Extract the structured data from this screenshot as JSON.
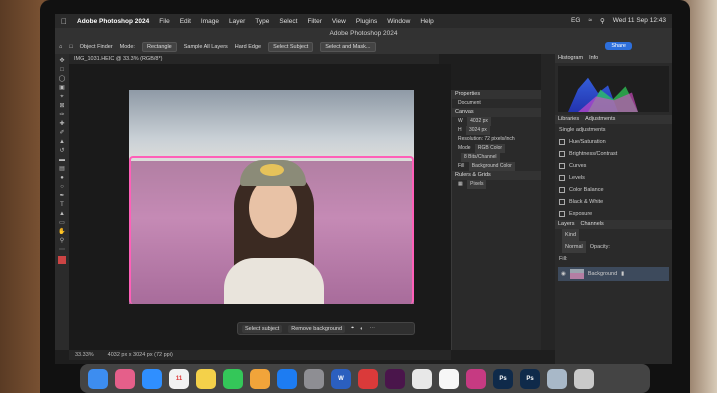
{
  "menubar": {
    "app_name": "Adobe Photoshop 2024",
    "items": [
      "File",
      "Edit",
      "Image",
      "Layer",
      "Type",
      "Select",
      "Filter",
      "View",
      "Plugins",
      "Window",
      "Help"
    ],
    "clock": "Wed 11 Sep 12:43",
    "input_indicator": "EG"
  },
  "titlebar": {
    "title": "Adobe Photoshop 2024"
  },
  "options": {
    "object_finder": "Object Finder",
    "mode_label": "Mode:",
    "mode_value": "Rectangle",
    "sample_all_layers": "Sample All Layers",
    "hard_edge": "Hard Edge",
    "select_subject": "Select Subject",
    "select_and_mask": "Select and Mask...",
    "share": "Share"
  },
  "document": {
    "tab_title": "IMG_1031.HEIC @ 33.3% (RGB/8*)"
  },
  "context_bar": {
    "select_subject": "Select subject",
    "remove_background": "Remove background"
  },
  "status": {
    "zoom": "33.33%",
    "dimensions": "4032 px x 3024 px (72 ppi)"
  },
  "properties": {
    "header": "Properties",
    "document_label": "Document",
    "canvas_header": "Canvas",
    "width": "4032 px",
    "height": "3024 px",
    "resolution": "Resolution: 72 pixels/inch",
    "mode_label": "Mode",
    "mode_value": "RGB Color",
    "bits_value": "8 Bits/Channel",
    "fill_label": "Fill",
    "fill_value": "Background Color",
    "rulers_header": "Rulers & Grids",
    "units_value": "Pixels"
  },
  "right_panel": {
    "tabs_top": [
      "Histogram",
      "Info"
    ],
    "tabs_mid": [
      "Libraries",
      "Adjustments"
    ],
    "single_adjustments": "Single adjustments",
    "adjustments": [
      "Hue/Saturation",
      "Brightness/Contrast",
      "Curves",
      "Levels",
      "Color Balance",
      "Black & White",
      "Exposure"
    ],
    "tabs_layers": [
      "Layers",
      "Channels"
    ],
    "kind_label": "Kind",
    "blend_mode": "Normal",
    "opacity_label": "Opacity:",
    "fill_label": "Fill:",
    "layer_name": "Background"
  },
  "dock": {
    "apps": [
      {
        "name": "finder",
        "label": "",
        "color": "#3d8df0"
      },
      {
        "name": "launchpad",
        "label": "",
        "color": "#e55f8a"
      },
      {
        "name": "safari",
        "label": "",
        "color": "#2f8fff"
      },
      {
        "name": "calendar",
        "label": "11",
        "color": "#f2f2f2"
      },
      {
        "name": "notes",
        "label": "",
        "color": "#f4d14a"
      },
      {
        "name": "messages",
        "label": "",
        "color": "#34c759"
      },
      {
        "name": "photos",
        "label": "",
        "color": "#f1a43a"
      },
      {
        "name": "app-store",
        "label": "",
        "color": "#1d7cf2"
      },
      {
        "name": "system-settings",
        "label": "",
        "color": "#8e8e93"
      },
      {
        "name": "word",
        "label": "W",
        "color": "#2b5fbf"
      },
      {
        "name": "creative-cloud",
        "label": "",
        "color": "#da3a3a"
      },
      {
        "name": "slack",
        "label": "",
        "color": "#4a154b"
      },
      {
        "name": "chrome",
        "label": "",
        "color": "#e8e8e8"
      },
      {
        "name": "reminders",
        "label": "",
        "color": "#f7f7f7"
      },
      {
        "name": "adobe-cc",
        "label": "",
        "color": "#c63a82"
      },
      {
        "name": "photoshop",
        "label": "Ps",
        "color": "#0f2a4a"
      },
      {
        "name": "photoshop-2",
        "label": "Ps",
        "color": "#0f2a4a"
      },
      {
        "name": "preview",
        "label": "",
        "color": "#a8b8c8"
      },
      {
        "name": "trash",
        "label": "",
        "color": "#c9c9c9"
      }
    ]
  }
}
